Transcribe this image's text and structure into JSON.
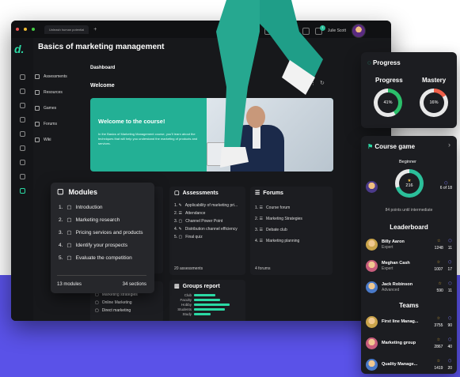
{
  "browser": {
    "tab_label": "Unleash human potential",
    "new_tab": "+"
  },
  "header": {
    "user_name": "Julie Scott",
    "badges": [
      "1",
      "2",
      "1"
    ]
  },
  "course": {
    "title": "Basics of marketing management"
  },
  "sidebar": {
    "items": [
      {
        "label": "Assessments",
        "icon": "document-icon"
      },
      {
        "label": "Resources",
        "icon": "file-icon"
      },
      {
        "label": "Games",
        "icon": "games-icon"
      },
      {
        "label": "Forums",
        "icon": "list-icon"
      },
      {
        "label": "Wiki",
        "icon": "link-icon"
      }
    ]
  },
  "dashboard": {
    "label": "Dashboard",
    "welcome": "Welcome"
  },
  "hero": {
    "title": "Welcome to the course!",
    "text": "In the Basics of Marketing Management course, you'll learn about the techniques that will help you understand the marketing of products and services."
  },
  "modules": {
    "title": "Modules",
    "items": [
      "Introduction",
      "Marketing research",
      "Pricing services and products",
      "Identify your prospects",
      "Evaluate the competition"
    ],
    "count": "13 modules",
    "sections": "34 sections"
  },
  "assessments": {
    "title": "Assessments",
    "items": [
      "Applicability of marketing pri...",
      "Attendance",
      "Channel Power Point",
      "Distribution channel efficiency",
      "Final quiz"
    ],
    "count": "20 assessments"
  },
  "forums": {
    "title": "Forums",
    "items": [
      "Course forum",
      "Marketing Strategies",
      "Debate club",
      "Marketing planning"
    ],
    "count": "4 forums"
  },
  "resources_partial": {
    "items": [
      "Marketing strategies",
      "Online Marketing",
      "Direct marketing"
    ],
    "fragments": [
      "ds",
      "ctions"
    ]
  },
  "groups_report": {
    "title": "Groups report",
    "labels": [
      "Club",
      "Faculty",
      "Hobby",
      "Students",
      "Study"
    ],
    "values": [
      0.45,
      0.55,
      0.75,
      0.65,
      0.35
    ]
  },
  "progress": {
    "title": "Progress",
    "progress_label": "Progress",
    "progress_value": "41%",
    "progress_fraction": 0.41,
    "mastery_label": "Mastery",
    "mastery_value": "16%",
    "mastery_fraction": 0.16,
    "progress_color": "#2bbf6a",
    "mastery_color": "#f0604a"
  },
  "game": {
    "title": "Course game",
    "level": "Beginner",
    "points": "216",
    "rank": "6 of 18",
    "until": "84 points until intermediate",
    "leaderboard_title": "Leaderboard",
    "leaderboard": [
      {
        "name": "Billy Aaron",
        "role": "Expert",
        "points": "1248",
        "badges": "11"
      },
      {
        "name": "Meghan Cash",
        "role": "Expert",
        "points": "1007",
        "badges": "17"
      },
      {
        "name": "Jack Robinson",
        "role": "Advanced",
        "points": "590",
        "badges": "11"
      }
    ],
    "teams_title": "Teams",
    "teams": [
      {
        "name": "First line Manag...",
        "points": "3755",
        "badges": "90"
      },
      {
        "name": "Marketing group",
        "points": "2867",
        "badges": "40"
      },
      {
        "name": "Quality Manage...",
        "points": "1419",
        "badges": "20"
      }
    ]
  }
}
